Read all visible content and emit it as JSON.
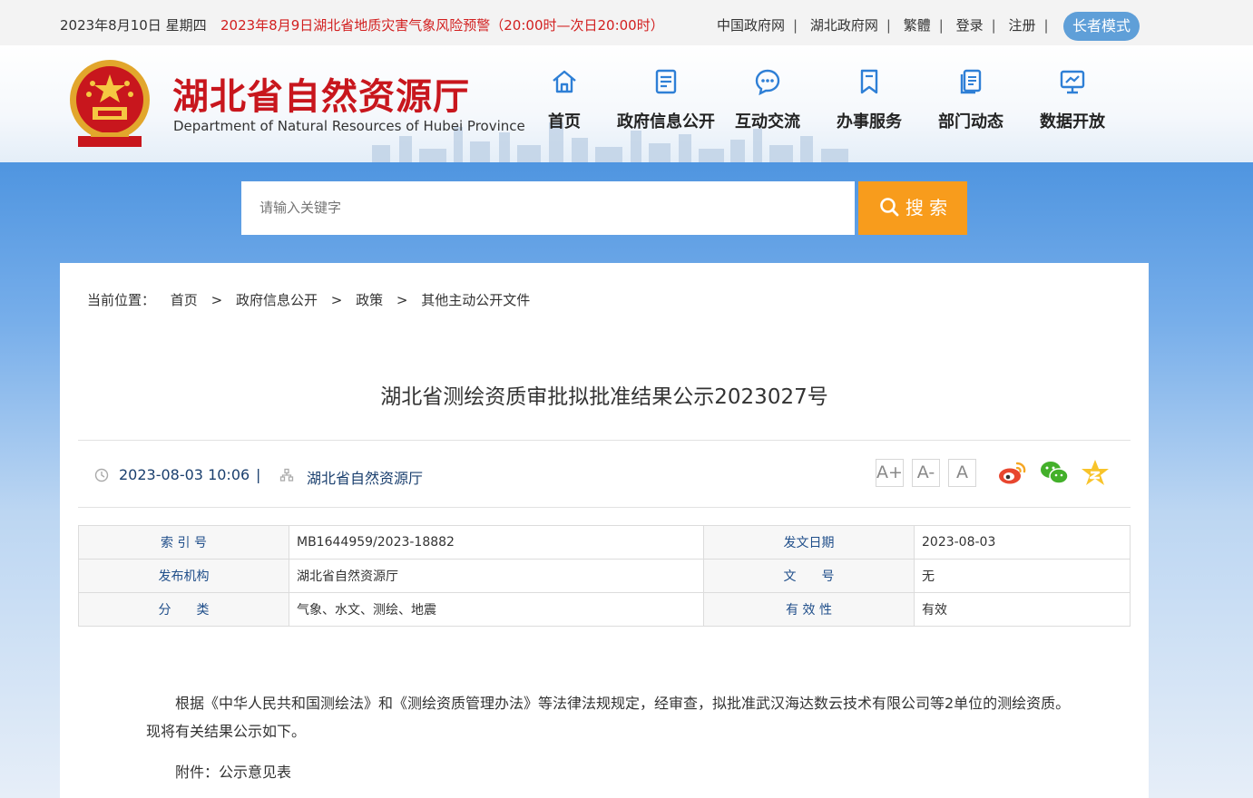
{
  "topbar": {
    "date": "2023年8月10日 星期四",
    "warning": "2023年8月9日湖北省地质灾害气象风险预警（20:00时—次日20:00时）",
    "links": [
      "中国政府网",
      "湖北政府网",
      "繁體",
      "登录",
      "注册"
    ],
    "elder_mode": "长者模式"
  },
  "header": {
    "title_cn": "湖北省自然资源厅",
    "title_en": "Department of Natural Resources of Hubei Province",
    "nav": [
      "首页",
      "政府信息公开",
      "互动交流",
      "办事服务",
      "部门动态",
      "数据开放"
    ]
  },
  "search": {
    "placeholder": "请输入关键字",
    "button": "搜 索"
  },
  "breadcrumb": {
    "label": "当前位置：",
    "items": [
      "首页",
      "政府信息公开",
      "政策",
      "其他主动公开文件"
    ],
    "sep": ">"
  },
  "article": {
    "title": "湖北省测绘资质审批拟批准结果公示2023027号",
    "datetime": "2023-08-03 10:06",
    "divider": "|",
    "publisher": "湖北省自然资源厅",
    "font_sizes": [
      "A+",
      "A-",
      "A"
    ],
    "body": "根据《中华人民共和国测绘法》和《测绘资质管理办法》等法律法规规定，经审查，拟批准武汉海达数云技术有限公司等2单位的测绘资质。现将有关结果公示如下。",
    "attachment": "附件：公示意见表"
  },
  "info_table": {
    "rows": [
      {
        "k1": "索 引 号",
        "v1": "MB1644959/2023-18882",
        "k2": "发文日期",
        "v2": "2023-08-03"
      },
      {
        "k1": "发布机构",
        "v1": "湖北省自然资源厅",
        "k2": "文　　号",
        "v2": "无"
      },
      {
        "k1": "分　　类",
        "v1": "气象、水文、测绘、地震",
        "k2": "有 效 性",
        "v2": "有效"
      }
    ]
  },
  "colors": {
    "brand_red": "#c8161d",
    "nav_blue": "#2e7fd6",
    "search_orange": "#f89c1c",
    "elder_blue": "#5f9fd8"
  },
  "icons": [
    "home-icon",
    "document-icon",
    "chat-icon",
    "bookmark-icon",
    "news-icon",
    "data-icon",
    "clock-icon",
    "org-icon",
    "weibo-icon",
    "wechat-icon",
    "qzone-icon",
    "search-icon"
  ]
}
